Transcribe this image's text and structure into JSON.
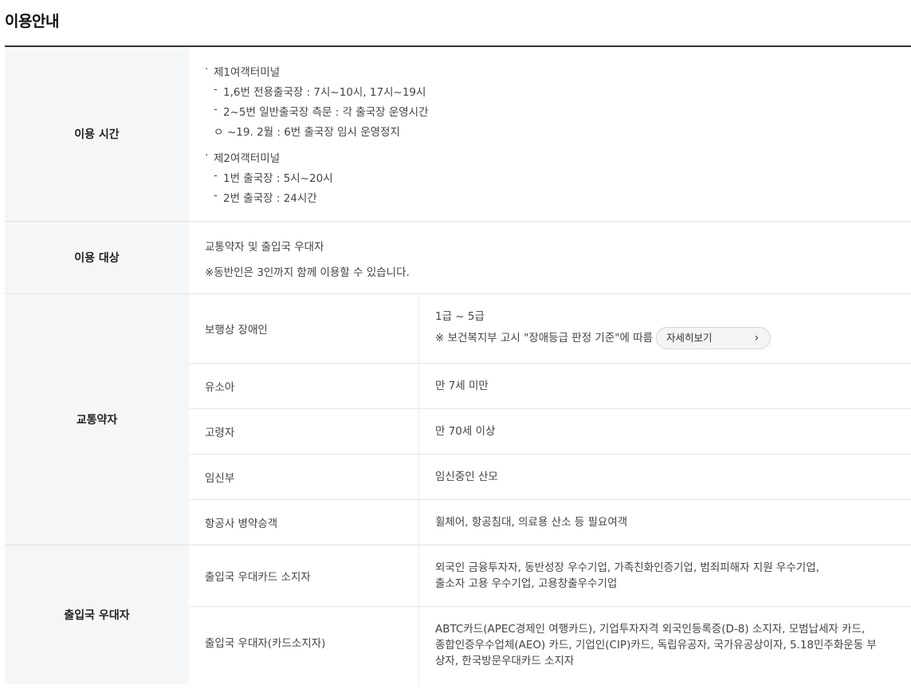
{
  "title": "이용안내",
  "hours": {
    "label": "이용 시간",
    "t1_title": "제1여객터미널",
    "t1_line1": "1,6번 전용출국장 : 7시~10시, 17시~19시",
    "t1_line2": "2~5번 일반출국장 측문 : 각 출국장 운영시간",
    "t1_note": "~19. 2월 : 6번 출국장 임시 운영정지",
    "t2_title": "제2여객터미널",
    "t2_line1": "1번 출국장 : 5시~20시",
    "t2_line2": "2번 출국장 : 24시간",
    "bullet": "·",
    "dash": "-",
    "circle": "ㅇ"
  },
  "target": {
    "label": "이용 대상",
    "line1": "교통약자 및 출입국 우대자",
    "line2": "※동반인은 3인까지 함께 이용할 수 있습니다."
  },
  "mobility": {
    "label": "교통약자",
    "rows": [
      {
        "key": "보행상 장애인",
        "value": "1급 ~ 5급",
        "note": "※ 보건복지부 고시 \"장애등급 판정 기준\"에 따름",
        "button": "자세히보기"
      },
      {
        "key": "유소아",
        "value": "만 7세 미만"
      },
      {
        "key": "고령자",
        "value": "만 70세 이상"
      },
      {
        "key": "임신부",
        "value": "임신중인 산모"
      },
      {
        "key": "항공사 병약승객",
        "value": "휠체어, 항공침대, 의료용 산소 등 필요여객"
      }
    ]
  },
  "vip": {
    "label": "출입국 우대자",
    "rows": [
      {
        "key": "출입국 우대카드 소지자",
        "value1": "외국인 금융투자자, 동반성장 우수기업, 가족친화인증기업, 범죄피해자 지원 우수기업,",
        "value2": "출소자 고용 우수기업, 고용창출우수기업"
      },
      {
        "key": "출입국 우대자(카드소지자)",
        "value1": "ABTC카드(APEC경제인 여행카드), 기업투자자격 외국인등록증(D-8) 소지자, 모범납세자 카드,",
        "value2": "종합인증우수업체(AEO) 카드, 기업인(CIP)카드, 독립유공자, 국가유공상이자, 5.18민주화운동 부",
        "value3": "상자, 한국방문우대카드 소지자"
      }
    ]
  },
  "icons": {
    "chevron": "chevron-right-icon"
  }
}
